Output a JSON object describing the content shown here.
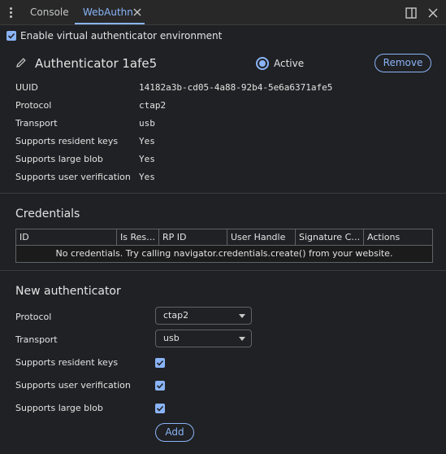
{
  "tabs": [
    {
      "label": "Console"
    },
    {
      "label": "WebAuthn"
    }
  ],
  "enable_label": "Enable virtual authenticator environment",
  "authenticator": {
    "title": "Authenticator 1afe5",
    "active_label": "Active",
    "remove_label": "Remove",
    "properties": [
      {
        "label": "UUID",
        "value": "14182a3b-cd05-4a88-92b4-5e6a6371afe5"
      },
      {
        "label": "Protocol",
        "value": "ctap2"
      },
      {
        "label": "Transport",
        "value": "usb"
      },
      {
        "label": "Supports resident keys",
        "value": "Yes"
      },
      {
        "label": "Supports large blob",
        "value": "Yes"
      },
      {
        "label": "Supports user verification",
        "value": "Yes"
      }
    ]
  },
  "credentials": {
    "title": "Credentials",
    "columns": [
      "ID",
      "Is Res…",
      "RP ID",
      "User Handle",
      "Signature C…",
      "Actions"
    ],
    "empty_message": "No credentials. Try calling navigator.credentials.create() from your website."
  },
  "new_authenticator": {
    "title": "New authenticator",
    "protocol_label": "Protocol",
    "protocol_value": "ctap2",
    "transport_label": "Transport",
    "transport_value": "usb",
    "resident_keys_label": "Supports resident keys",
    "user_verification_label": "Supports user verification",
    "large_blob_label": "Supports large blob",
    "add_label": "Add"
  },
  "colors": {
    "background": "#202124",
    "accent": "#8ab4f8",
    "text": "#e3e3e3",
    "border": "#5f6368"
  }
}
